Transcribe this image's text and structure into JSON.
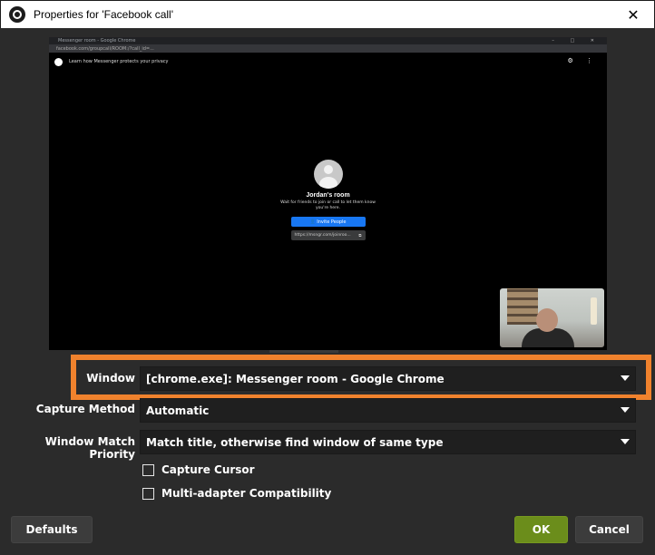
{
  "window": {
    "title": "Properties for 'Facebook call'",
    "close_glyph": "✕"
  },
  "preview": {
    "browser_tab": "Messenger room - Google Chrome",
    "window_controls": "–  □  ✕",
    "url": "facebook.com/groupcall/ROOM:/?call_id=...",
    "header_text": "Learn how Messenger protects your privacy",
    "header_icons": "⚙ ⋮",
    "room_name": "Jordan's room",
    "room_sub": "Wait for friends to join or call to let them know you're here.",
    "invite_label": "👤 Invite People",
    "link_text": "https://msngr.com/joinroo...",
    "link_icon": "⧉"
  },
  "fields": {
    "window_label": "Window",
    "window_value": "[chrome.exe]: Messenger room - Google Chrome",
    "capture_method_label": "Capture Method",
    "capture_method_value": "Automatic",
    "match_priority_label": "Window Match Priority",
    "match_priority_value": "Match title, otherwise find window of same type"
  },
  "checkboxes": {
    "capture_cursor": {
      "label": "Capture Cursor",
      "checked": false
    },
    "multi_adapter": {
      "label": "Multi-adapter Compatibility",
      "checked": false
    }
  },
  "buttons": {
    "defaults": "Defaults",
    "ok": "OK",
    "cancel": "Cancel"
  },
  "colors": {
    "highlight": "#f0822d",
    "ok_button": "#6b8d1b",
    "background": "#2b2b2b"
  }
}
